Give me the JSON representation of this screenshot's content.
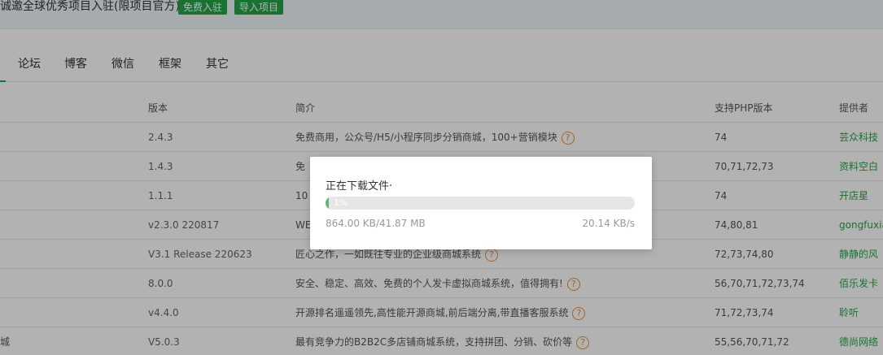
{
  "banner": {
    "text": "诚邀全球优秀项目入驻(限项目官方)",
    "free_button": "免费入驻",
    "import_button": "导入项目"
  },
  "tabs": [
    "论坛",
    "博客",
    "微信",
    "框架",
    "其它"
  ],
  "table": {
    "headers": {
      "version": "版本",
      "intro": "简介",
      "php": "支持PHP版本",
      "provider": "提供者"
    },
    "rows": [
      {
        "name": "",
        "version": "2.4.3",
        "intro": "免费商用，公众号/H5/小程序同步分销商城，100+营销模块",
        "php": "74",
        "provider": "芸众科技"
      },
      {
        "name": "",
        "version": "1.4.3",
        "intro": "免",
        "php": "70,71,72,73",
        "provider": "资料空白"
      },
      {
        "name": "",
        "version": "1.1.1",
        "intro": "10",
        "php": "74",
        "provider": "开店星"
      },
      {
        "name": "",
        "version": "v2.3.0 220817",
        "intro": "WE",
        "php": "74,80,81",
        "provider": "gongfuxia"
      },
      {
        "name": "",
        "version": "V3.1 Release 220623",
        "intro": "匠心之作，一如既往专业的企业级商城系统",
        "php": "72,73,74,80",
        "provider": "静静的风"
      },
      {
        "name": "",
        "version": "8.0.0",
        "intro": "安全、稳定、高效、免费的个人发卡虚拟商城系统，值得拥有!",
        "php": "56,70,71,72,73,74",
        "provider": "佰乐发卡"
      },
      {
        "name": "",
        "version": "v4.4.0",
        "intro": "开源排名遥遥领先,高性能开源商城,前后端分离,带直播客服系统",
        "php": "71,72,73,74",
        "provider": "聆听"
      },
      {
        "name": "城",
        "version": "V5.0.3",
        "intro": "最有竞争力的B2B2C多店铺商城系统，支持拼团、分销、砍价等",
        "php": "55,56,70,71,72",
        "provider": "德尚网络"
      }
    ],
    "help_rows": [
      0,
      4,
      5,
      6,
      7
    ]
  },
  "dialog": {
    "title": "正在下载文件·",
    "progress_label": "1%",
    "progress_fraction": 0.01,
    "downloaded": "864.00 KB/41.87 MB",
    "speed": "20.14 KB/s"
  },
  "colors": {
    "accent_green": "#23a547",
    "progress_green": "#5fb878",
    "help_orange": "#e8912e"
  },
  "icons": {
    "help": "question-circle-icon"
  }
}
